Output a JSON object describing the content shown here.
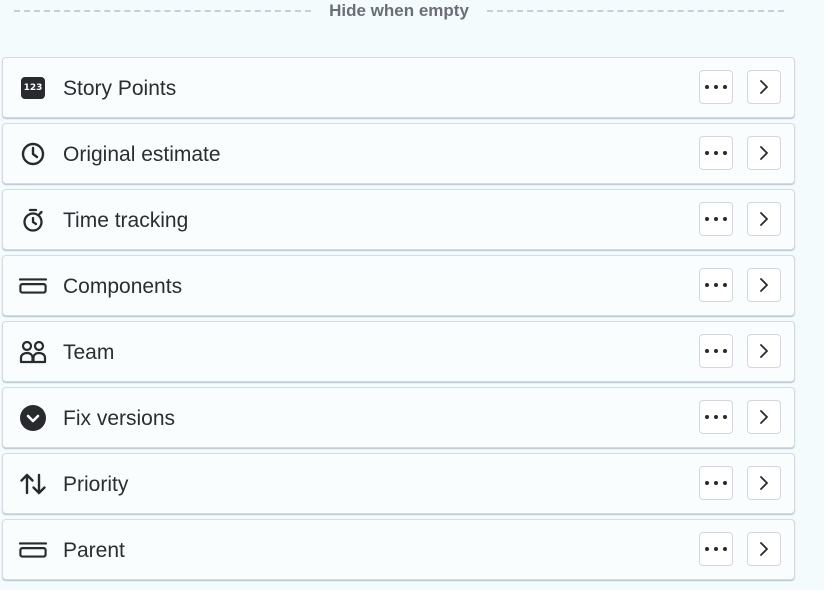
{
  "section": {
    "divider_label": "Hide when empty"
  },
  "fields": [
    {
      "label": "Story Points",
      "icon": "number-badge-icon",
      "icon_text": "123"
    },
    {
      "label": "Original estimate",
      "icon": "clock-icon"
    },
    {
      "label": "Time tracking",
      "icon": "stopwatch-icon"
    },
    {
      "label": "Components",
      "icon": "component-icon"
    },
    {
      "label": "Team",
      "icon": "people-icon"
    },
    {
      "label": "Fix versions",
      "icon": "version-chevron-icon"
    },
    {
      "label": "Priority",
      "icon": "priority-arrows-icon"
    },
    {
      "label": "Parent",
      "icon": "parent-icon"
    }
  ],
  "actions": {
    "more_icon": "more-dots-icon",
    "open_icon": "chevron-right-icon"
  },
  "colors": {
    "background": "#f4fbfd",
    "row_background": "#f9fdfe",
    "row_border": "#d7dade",
    "text": "#2c2d31",
    "divider_text": "#6b6e76",
    "icon": "#292a2e"
  }
}
